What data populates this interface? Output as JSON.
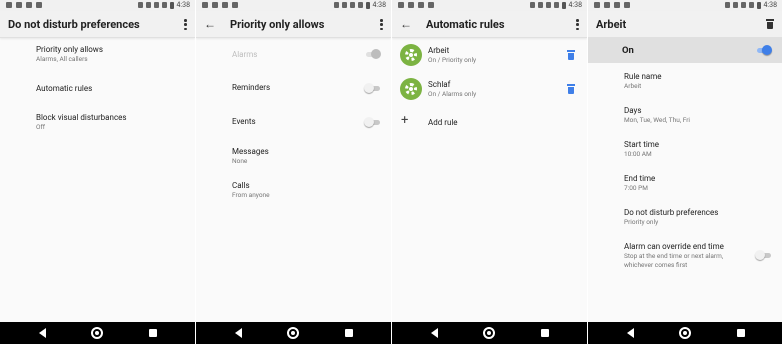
{
  "status": {
    "time": "4:38"
  },
  "panel1": {
    "title": "Do not disturb preferences",
    "items": [
      {
        "title": "Priority only allows",
        "sub": "Alarms, All callers"
      },
      {
        "title": "Automatic rules",
        "sub": ""
      },
      {
        "title": "Block visual disturbances",
        "sub": "Off"
      }
    ]
  },
  "panel2": {
    "title": "Priority only allows",
    "items": [
      {
        "title": "Alarms",
        "sub": ""
      },
      {
        "title": "Reminders",
        "sub": ""
      },
      {
        "title": "Events",
        "sub": ""
      },
      {
        "title": "Messages",
        "sub": "None"
      },
      {
        "title": "Calls",
        "sub": "From anyone"
      }
    ]
  },
  "panel3": {
    "title": "Automatic rules",
    "rules": [
      {
        "name": "Arbeit",
        "status": "On / Priority only"
      },
      {
        "name": "Schlaf",
        "status": "On / Alarms only"
      }
    ],
    "add_label": "Add rule"
  },
  "panel4": {
    "title": "Arbeit",
    "on_label": "On",
    "items": [
      {
        "title": "Rule name",
        "sub": "Arbeit"
      },
      {
        "title": "Days",
        "sub": "Mon, Tue, Wed, Thu, Fri"
      },
      {
        "title": "Start time",
        "sub": "10:00 AM"
      },
      {
        "title": "End time",
        "sub": "7:00 PM"
      },
      {
        "title": "Do not disturb preferences",
        "sub": "Priority only"
      },
      {
        "title": "Alarm can override end time",
        "sub": "Stop at the end time or next alarm,",
        "sub2": "whichever comes first"
      }
    ]
  },
  "colors": {
    "accent": "#3f7fe8",
    "rule_icon": "#7cb342",
    "appbar": "#f1f1f1",
    "on_bar": "#e0e0e0"
  },
  "icons": [
    "back-arrow",
    "overflow-menu",
    "trash",
    "gear",
    "plus",
    "nav-back",
    "nav-home",
    "nav-recents"
  ]
}
